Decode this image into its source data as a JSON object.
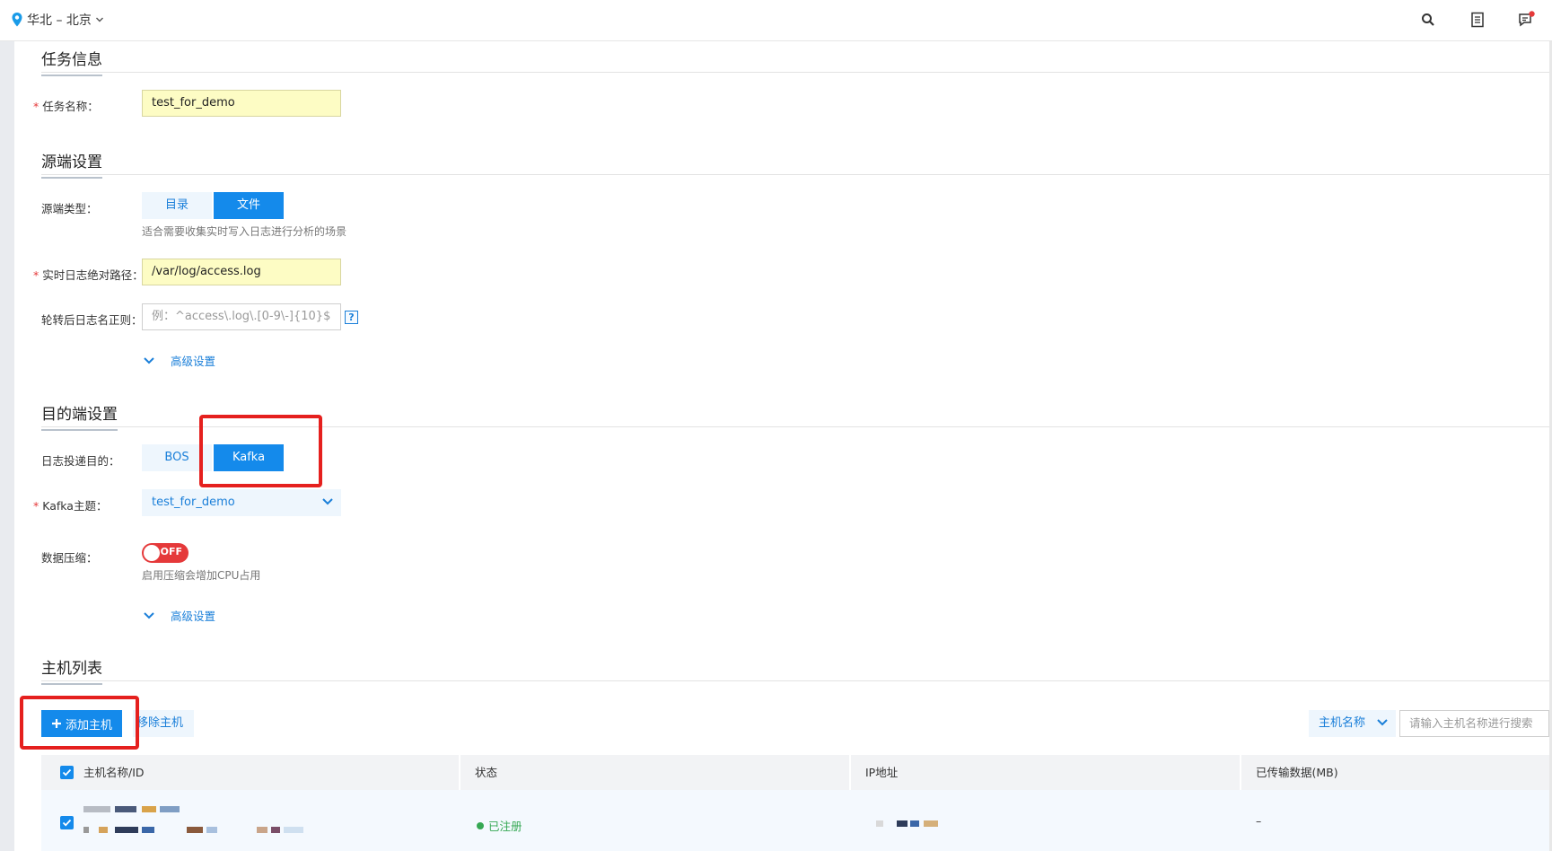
{
  "topbar": {
    "region": "华北 – 北京",
    "icons": [
      "search-icon",
      "document-icon",
      "message-icon"
    ],
    "notification_color": "#e5393a"
  },
  "task_info": {
    "section_title": "任务信息",
    "name_label": "任务名称：",
    "name_value": "test_for_demo"
  },
  "source": {
    "section_title": "源端设置",
    "type_label": "源端类型：",
    "type_options": [
      "目录",
      "文件"
    ],
    "type_selected": "文件",
    "type_hint": "适合需要收集实时写入日志进行分析的场景",
    "path_label": "实时日志绝对路径：",
    "path_value": "/var/log/access.log",
    "rotate_label": "轮转后日志名正则：",
    "rotate_placeholder": "例：^access\\.log\\.[0-9\\-]{10}$",
    "help": "?",
    "advanced": "高级设置"
  },
  "destination": {
    "section_title": "目的端设置",
    "target_label": "日志投递目的：",
    "target_options": [
      "BOS",
      "Kafka"
    ],
    "target_selected": "Kafka",
    "topic_label": "Kafka主题：",
    "topic_value": "test_for_demo",
    "compress_label": "数据压缩：",
    "compress_state": "OFF",
    "compress_hint": "启用压缩会增加CPU占用",
    "advanced": "高级设置"
  },
  "hosts": {
    "section_title": "主机列表",
    "add_button": "添加主机",
    "remove_button": "移除主机",
    "filter_select": "主机名称",
    "search_placeholder": "请输入主机名称进行搜索",
    "columns": [
      "主机名称/ID",
      "状态",
      "IP地址",
      "已传输数据(MB)"
    ],
    "rows": [
      {
        "status": "已注册",
        "transferred": "–"
      }
    ]
  },
  "colors": {
    "accent": "#148aeb",
    "link": "#1a7fd9",
    "highlight": "#e5201e",
    "success": "#35a853",
    "filled_input": "#fdfcc4"
  }
}
